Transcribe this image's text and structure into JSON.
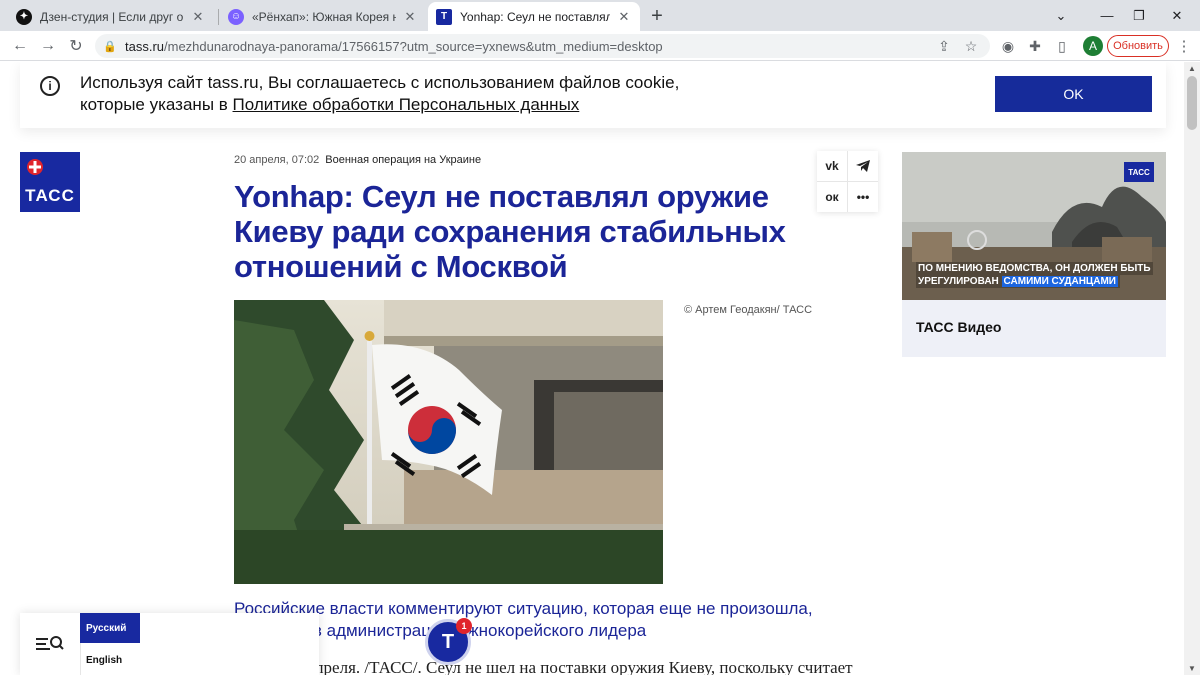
{
  "browser": {
    "tabs": [
      {
        "title": "Дзен-студия | Если друг оказало",
        "favicon": "zen-icon"
      },
      {
        "title": "«Рёнхап»: Южная Корея не пос",
        "favicon": "emoji-face-icon"
      },
      {
        "title": "Yonhap: Сеул не поставлял оруж",
        "favicon": "tass-t-icon"
      }
    ],
    "window_controls": [
      "chevron-down",
      "minimize",
      "restore",
      "close"
    ],
    "url_host": "tass.ru",
    "url_path": "/mezhdunarodnaya-panorama/17566157?utm_source=yxnews&utm_medium=desktop",
    "profile_initial": "A",
    "update_label": "Обновить"
  },
  "cookie": {
    "message_pre": "Используя сайт tass.ru, Вы соглашаетесь с использованием файлов cookie, которые указаны в ",
    "message_link": "Политике обработки Персональных данных",
    "ok_label": "OK"
  },
  "logo_text": "ТАСС",
  "article": {
    "date": "20 апреля, 07:02",
    "category": "Военная операция на Украине",
    "headline": "Yonhap: Сеул не поставлял оружие Киеву ради сохранения стабильных отношений с Москвой",
    "photo_credit": "© Артем Геодакян/ ТАСС",
    "lead": "Российские власти комментируют ситуацию, которая еще не произошла, отметили в администрации южнокорейского лидера",
    "body_start": "СЕУЛ, 20 апреля. /ТАСС/. Сеул не шел на поставки оружия Киеву, поскольку считает"
  },
  "share": [
    "vk-icon",
    "telegram-icon",
    "odnoklassniki-icon",
    "more-icon"
  ],
  "video": {
    "badge": "ТАСС",
    "caption_line1": "ПО МНЕНИЮ ВЕДОМСТВА, ОН ДОЛЖЕН БЫТЬ",
    "caption_line2_pre": "УРЕГУЛИРОВАН ",
    "caption_line2_hl": "САМИМИ СУДАНЦАМИ",
    "label": "ТАСС Видео"
  },
  "languages": {
    "active": "Русский",
    "other": "English"
  },
  "notification_count": "1",
  "colors": {
    "brand": "#1829a0",
    "headline": "#1b2597",
    "update": "#d93025"
  }
}
